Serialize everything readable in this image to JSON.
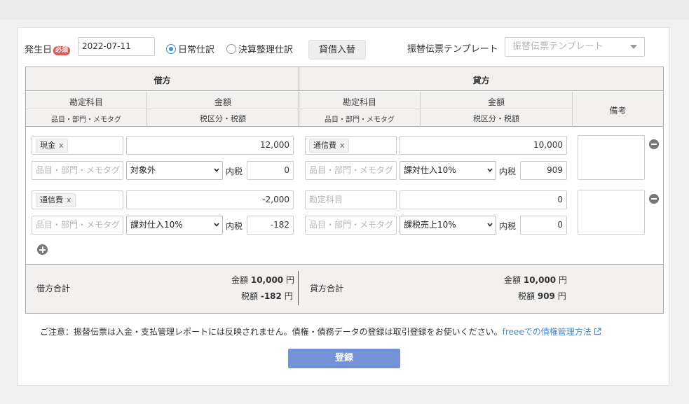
{
  "form": {
    "date_label": "発生日",
    "required_badge": "必須",
    "date_value": "2022-07-11",
    "radio_normal": "日常仕訳",
    "radio_closing": "決算整理仕訳",
    "swap_button": "貸借入替",
    "template_label": "振替伝票テンプレート",
    "template_placeholder": "振替伝票テンプレート"
  },
  "table": {
    "debit_header": "借方",
    "credit_header": "貸方",
    "account_header": "勘定科目",
    "account_sub": "品目・部門・メモタグ",
    "amount_header": "金額",
    "amount_sub": "税区分・税額",
    "memo_header": "備考",
    "detail_placeholder": "品目・部門・メモタグ",
    "account_placeholder": "勘定科目",
    "tax_included_label": "内税",
    "rows": [
      {
        "debit": {
          "account": "現金",
          "amount": "12,000",
          "tax_category": "対象外",
          "tax": "0"
        },
        "credit": {
          "account": "通信費",
          "amount": "10,000",
          "tax_category": "課対仕入10%",
          "tax": "909"
        }
      },
      {
        "debit": {
          "account": "通信費",
          "amount": "-2,000",
          "tax_category": "課対仕入10%",
          "tax": "-182"
        },
        "credit": {
          "account": "",
          "amount": "0",
          "tax_category": "課税売上10%",
          "tax": "0"
        }
      }
    ]
  },
  "totals": {
    "debit_label": "借方合計",
    "credit_label": "貸方合計",
    "amount_label": "金額",
    "tax_label": "税額",
    "yen": "円",
    "debit_amount": "10,000",
    "debit_tax": "-182",
    "credit_amount": "10,000",
    "credit_tax": "909"
  },
  "notice": {
    "text": "ご注意：振替伝票は入金・支払管理レポートには反映されません。債権・債務データの登録は取引登録をお使いください。",
    "link": "freeeでの債権管理方法"
  },
  "submit_label": "登録",
  "colors": {
    "primary": "#7392d8",
    "accent": "#3a8ee6",
    "required": "#dc5b5b"
  }
}
